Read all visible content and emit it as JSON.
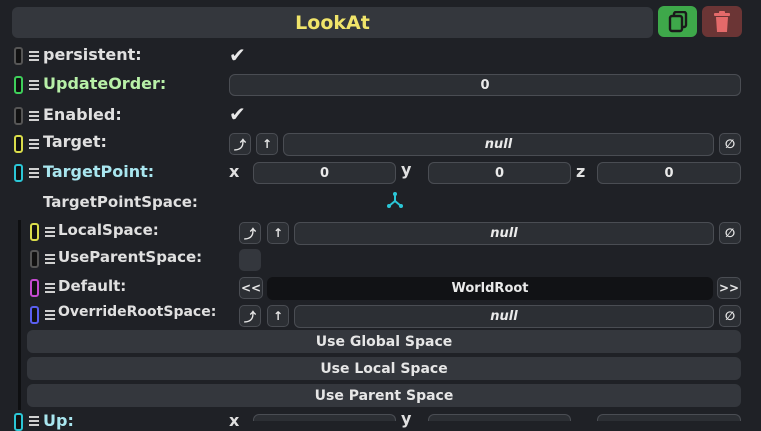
{
  "header": {
    "title": "LookAt",
    "duplicate_icon": "duplicate-icon",
    "delete_icon": "trash-icon"
  },
  "rows": {
    "persistent": {
      "label": "persistent:",
      "checked": true
    },
    "update_order": {
      "label": "UpdateOrder:",
      "value": "0"
    },
    "enabled": {
      "label": "Enabled:",
      "checked": true
    },
    "target": {
      "label": "Target:",
      "value": "null"
    },
    "target_point": {
      "label": "TargetPoint:",
      "x_label": "x",
      "x": "0",
      "y_label": "y",
      "y": "0",
      "z_label": "z",
      "z": "0"
    },
    "target_point_space": {
      "label": "TargetPointSpace:"
    },
    "local_space": {
      "label": "LocalSpace:",
      "value": "null"
    },
    "use_parent_space": {
      "label": "UseParentSpace:"
    },
    "default": {
      "label": "Default:",
      "value": "WorldRoot",
      "prev": "<<",
      "next": ">>"
    },
    "override_root_space": {
      "label": "OverrideRootSpace:",
      "value": "null"
    },
    "up": {
      "label": "Up:",
      "x_label": "x",
      "y_label": "y"
    }
  },
  "buttons": {
    "use_global": "Use Global Space",
    "use_local": "Use Local Space",
    "use_parent": "Use Parent Space"
  },
  "glyphs": {
    "jump": "⤴",
    "up": "↑",
    "clear": "∅",
    "check": "✔",
    "tri": "⁂"
  },
  "colors": {
    "title": "#f0e46a",
    "green_accent": "#3ecf5a",
    "cyan_accent": "#2bc6d6",
    "yellow_accent": "#d9dc4a",
    "purple_accent": "#c44ad0",
    "blue_accent": "#5a5ff0",
    "delete_bg": "#e46a6a"
  }
}
